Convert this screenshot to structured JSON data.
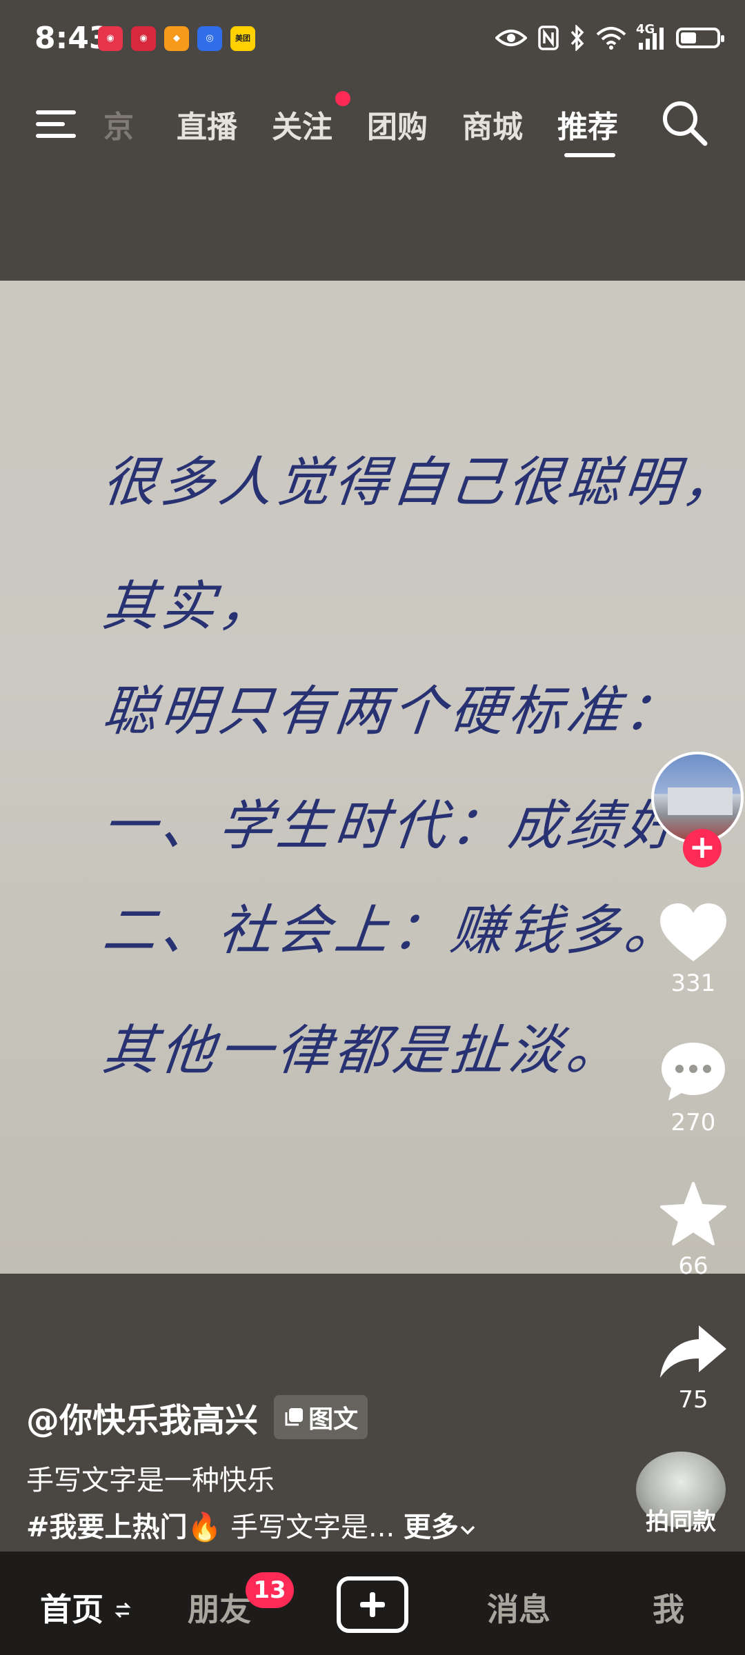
{
  "status_bar": {
    "time": "8:43",
    "notif_apps": [
      {
        "icon": "red-app-icon",
        "color": "#e8344a"
      },
      {
        "icon": "red-app-icon",
        "color": "#d8283c"
      },
      {
        "icon": "orange-app-icon",
        "color": "#f59a1b"
      },
      {
        "icon": "blue-app-icon",
        "color": "#2f6ee8"
      },
      {
        "icon": "meituan-icon",
        "color": "#ffd100",
        "label": "美团"
      }
    ],
    "network": "4G",
    "battery_level": 0.45
  },
  "top_nav": {
    "tabs": [
      {
        "label": "京",
        "state": "faded"
      },
      {
        "label": "直播",
        "state": "normal"
      },
      {
        "label": "关注",
        "state": "normal",
        "has_dot": true
      },
      {
        "label": "团购",
        "state": "normal"
      },
      {
        "label": "商城",
        "state": "normal"
      },
      {
        "label": "推荐",
        "state": "active"
      }
    ]
  },
  "post": {
    "handwriting_lines": [
      "很多人觉得自己很聪明，",
      "其实，",
      "聪明只有两个硬标准：",
      "一、学生时代：成绩好；",
      "二、社会上：赚钱多。",
      "其他一律都是扯淡。"
    ],
    "author": "@你快乐我高兴",
    "type_badge": "图文",
    "description": "手写文字是一种快乐",
    "hashtag": "#我要上热门",
    "hashtag_emoji": "🔥",
    "caption_preview": "手写文字是...",
    "more_label": "更多"
  },
  "actions": {
    "likes": "331",
    "comments": "270",
    "favorites": "66",
    "shares": "75",
    "same_style_label": "拍同款"
  },
  "bottom_nav": {
    "home": "首页",
    "friends": "朋友",
    "friends_badge": "13",
    "messages": "消息",
    "me": "我"
  },
  "colors": {
    "accent": "#ff2a55",
    "ink": "#283272",
    "background": "#4a4742"
  }
}
